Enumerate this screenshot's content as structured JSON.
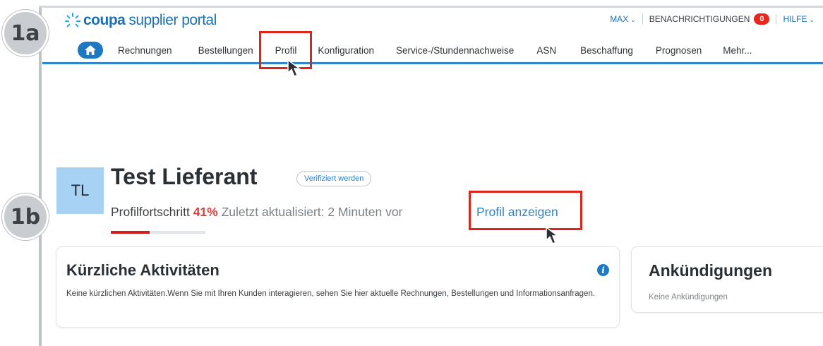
{
  "callouts": {
    "step_a": "1a",
    "step_b": "1b"
  },
  "header": {
    "logo_brand": "coupa",
    "logo_suffix": "supplier portal",
    "user_menu": "MAX",
    "notifications_label": "BENACHRICHTIGUNGEN",
    "notifications_count": "0",
    "help_menu": "HILFE"
  },
  "nav": {
    "items": [
      "Rechnungen",
      "Bestellungen",
      "Profil",
      "Konfiguration",
      "Service-/Stundennachweise",
      "ASN",
      "Beschaffung",
      "Prognosen",
      "Mehr..."
    ]
  },
  "profile": {
    "initials": "TL",
    "company_name": "Test Lieferant",
    "verify_label": "Verifiziert werden",
    "progress_label": "Profilfortschritt",
    "progress_percent": "41%",
    "progress_value": 0.41,
    "last_updated": "Zuletzt aktualisiert: 2 Minuten vor",
    "view_profile_link": "Profil anzeigen"
  },
  "activity": {
    "title": "Kürzliche Aktivitäten",
    "body": "Keine kürzlichen Aktivitäten.Wenn Sie mit Ihren Kunden interagieren, sehen Sie hier aktuelle Rechnungen, Bestellungen und Informationsanfragen."
  },
  "announcements": {
    "title": "Ankündigungen",
    "body": "Keine Ankündigungen"
  },
  "colors": {
    "brand_blue": "#1b6fb5",
    "highlight_red": "#e2231a",
    "progress_red": "#d11f1f",
    "avatar_blue": "#a7d2f3"
  }
}
